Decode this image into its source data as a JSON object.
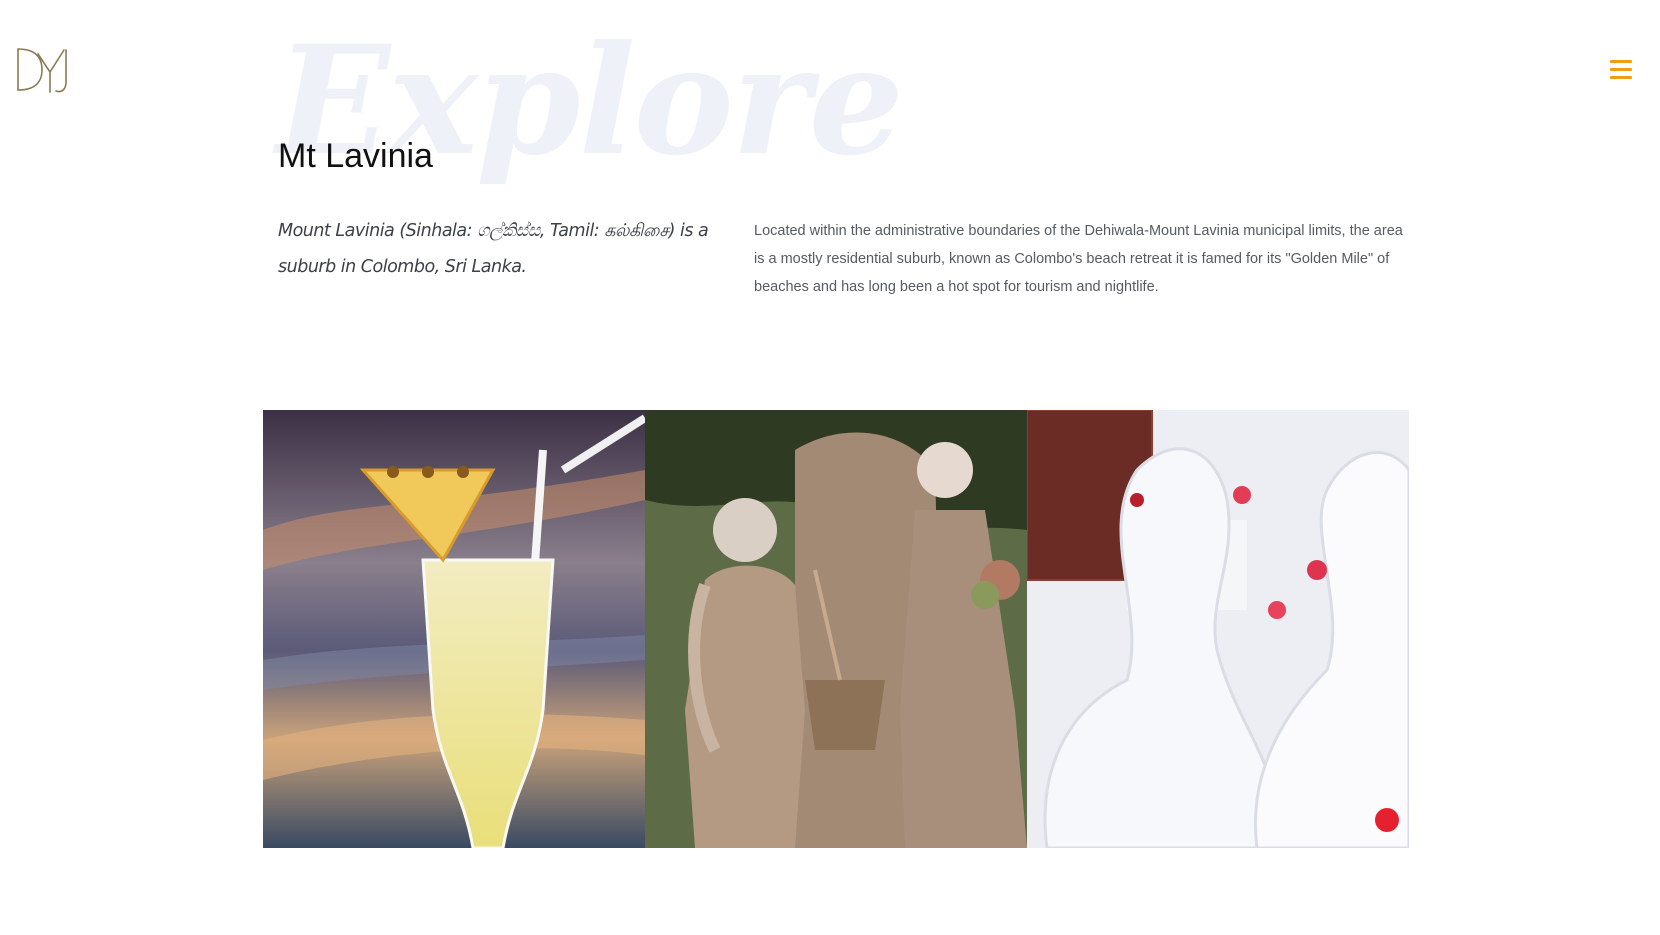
{
  "header": {
    "logo_text": "DYJ",
    "menu_icon": "hamburger-menu-icon",
    "accent_color": "#f39c12"
  },
  "hero": {
    "watermark": "Explore",
    "title": "Mt Lavinia"
  },
  "intro": {
    "lead": "Mount Lavinia (Sinhala: ගල්කිස්ස, Tamil: கல்கிசை) is a suburb in Colombo, Sri Lanka.",
    "description": "Located within the administrative boundaries of the Dehiwala-Mount Lavinia municipal limits, the area is a mostly residential suburb, known as Colombo's beach retreat it is famed for its \"Golden Mile\" of beaches and has long been a hot spot for tourism and nightlife."
  },
  "gallery": {
    "images": [
      {
        "subject": "pineapple-cocktail",
        "icon": "cocktail-photo"
      },
      {
        "subject": "garden-statues",
        "icon": "statue-photo"
      },
      {
        "subject": "towel-swans",
        "icon": "towel-swan-photo"
      }
    ]
  }
}
